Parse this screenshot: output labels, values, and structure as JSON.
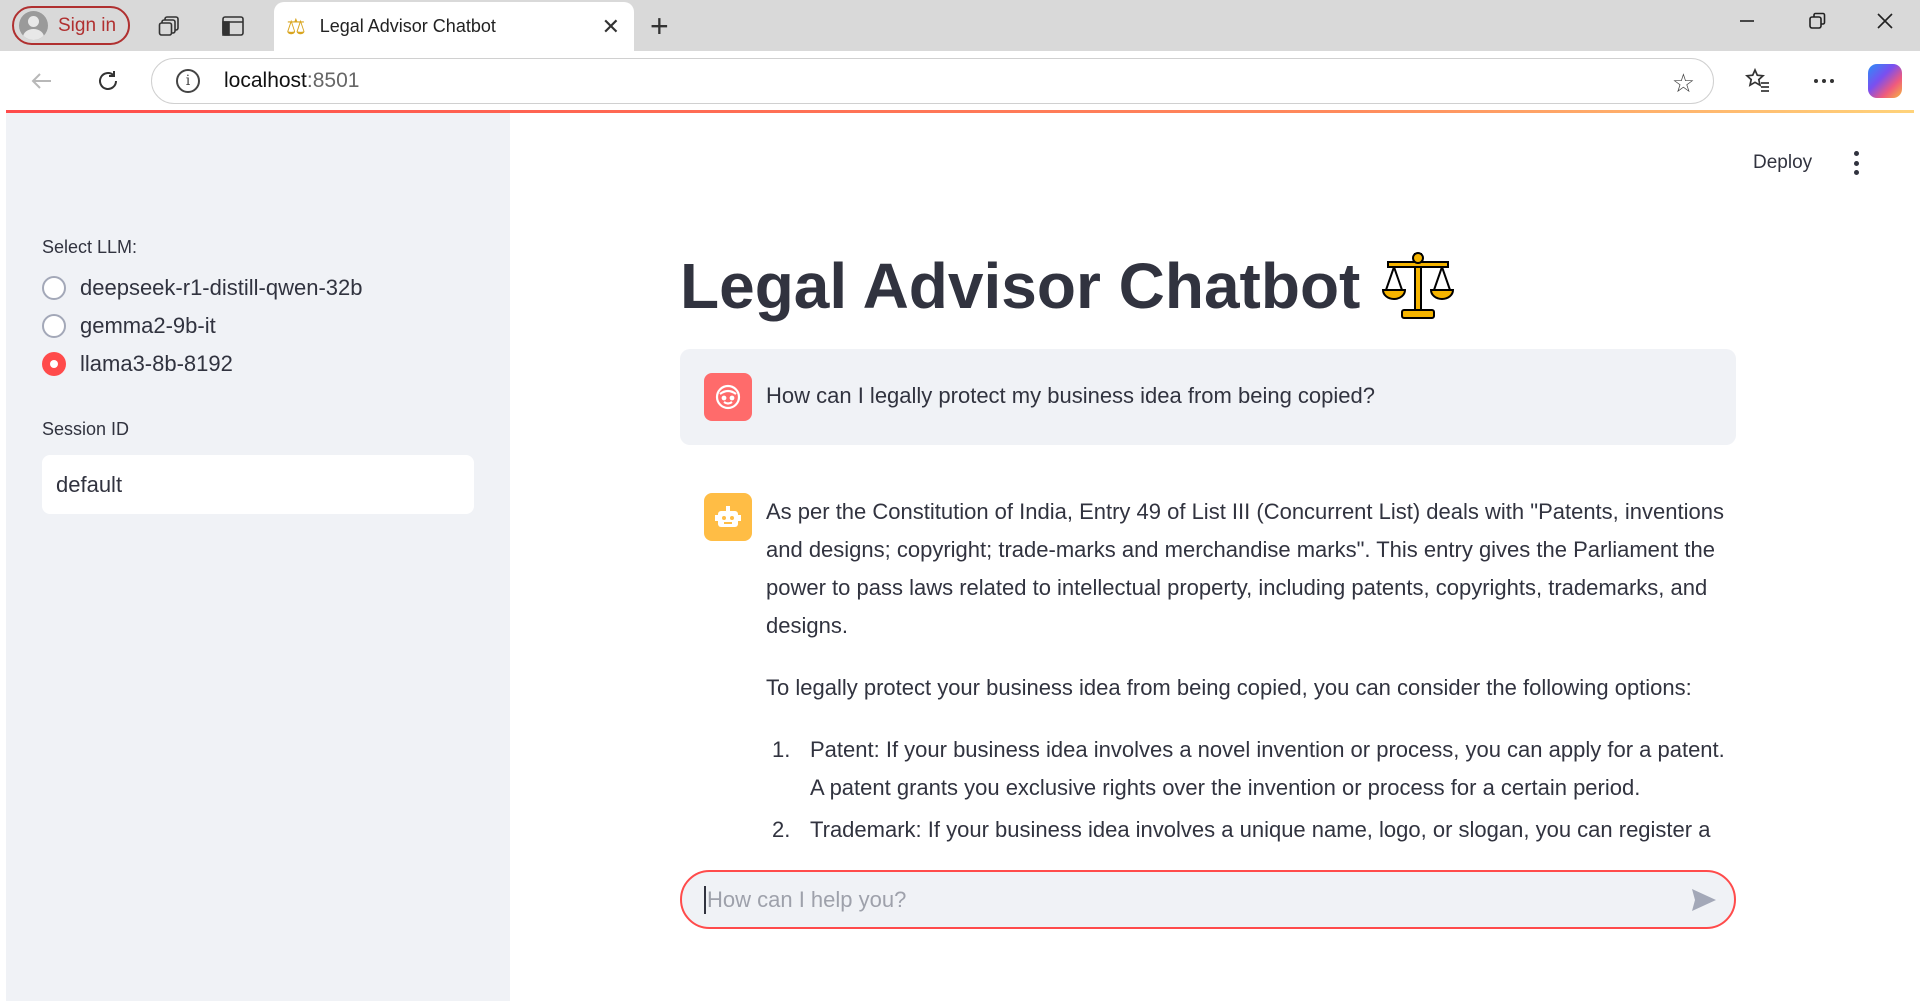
{
  "browser": {
    "sign_in_label": "Sign in",
    "tab_title": "Legal Advisor Chatbot",
    "url_host": "localhost",
    "url_port": ":8501"
  },
  "sidebar": {
    "select_llm_label": "Select LLM:",
    "llm_options": [
      {
        "label": "deepseek-r1-distill-qwen-32b",
        "selected": false
      },
      {
        "label": "gemma2-9b-it",
        "selected": false
      },
      {
        "label": "llama3-8b-8192",
        "selected": true
      }
    ],
    "session_label": "Session ID",
    "session_value": "default"
  },
  "header": {
    "deploy_label": "Deploy"
  },
  "main": {
    "title": "Legal Advisor Chatbot",
    "messages": [
      {
        "role": "user",
        "text": "How can I legally protect my business idea from being copied?"
      },
      {
        "role": "assistant",
        "paragraph1": "As per the Constitution of India, Entry 49 of List III (Concurrent List) deals with \"Patents, inventions and designs; copyright; trade-marks and merchandise marks\". This entry gives the Parliament the power to pass laws related to intellectual property, including patents, copyrights, trademarks, and designs.",
        "paragraph2": "To legally protect your business idea from being copied, you can consider the following options:",
        "list": [
          {
            "num": "1.",
            "text": "Patent: If your business idea involves a novel invention or process, you can apply for a patent. A patent grants you exclusive rights over the invention or process for a certain period."
          },
          {
            "num": "2.",
            "text": "Trademark: If your business idea involves a unique name, logo, or slogan, you can register a"
          }
        ]
      }
    ],
    "chat_placeholder": "How can I help you?"
  },
  "colors": {
    "accent": "#ff4b4b",
    "sidebar_bg": "#f0f2f6",
    "text": "#31333f",
    "user_avatar": "#ff6b6b",
    "bot_avatar": "#ffbd45"
  }
}
